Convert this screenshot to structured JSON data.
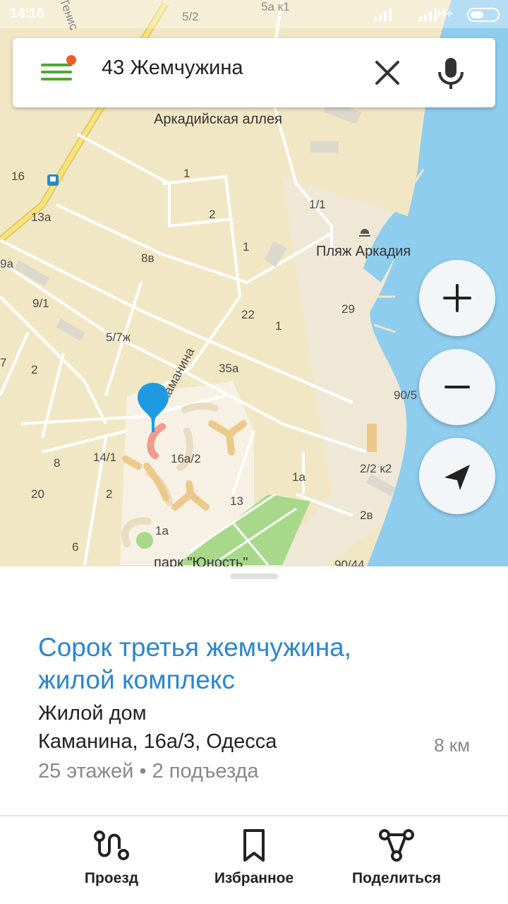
{
  "status_bar": {
    "time": "14:16",
    "network": "H+"
  },
  "search": {
    "query": "43 Жемчужина"
  },
  "map": {
    "labels": [
      "5/2",
      "5а к1",
      "Аркадийская аллея",
      "16",
      "1",
      "2",
      "13а",
      "1/1",
      "1",
      "8в",
      "Пляж Аркадия",
      "9а",
      "9/1",
      "22",
      "29",
      "5/7ж",
      "1",
      "Каманина",
      "35а",
      "7",
      "2",
      "90/5",
      "16а/2",
      "14/1",
      "8",
      "2/2 к2",
      "1а",
      "20",
      "2",
      "13",
      "2в",
      "1а",
      "6",
      "парк \"Юность\"",
      "90/44",
      "Тенис"
    ]
  },
  "place": {
    "title": "Сорок третья жемчужина, жилой комплекс",
    "category": "Жилой дом",
    "address": "Каманина, 16а/3, Одесса",
    "distance": "8 км",
    "details": "25 этажей • 2 подъезда"
  },
  "actions": {
    "route": "Проезд",
    "favorites": "Избранное",
    "share": "Поделиться"
  },
  "colors": {
    "accent": "#2a86d0",
    "menu": "#51a635",
    "notification": "#f15a24",
    "water": "#8ecdee",
    "park": "#a8d88a",
    "land": "#f2e7c4"
  }
}
